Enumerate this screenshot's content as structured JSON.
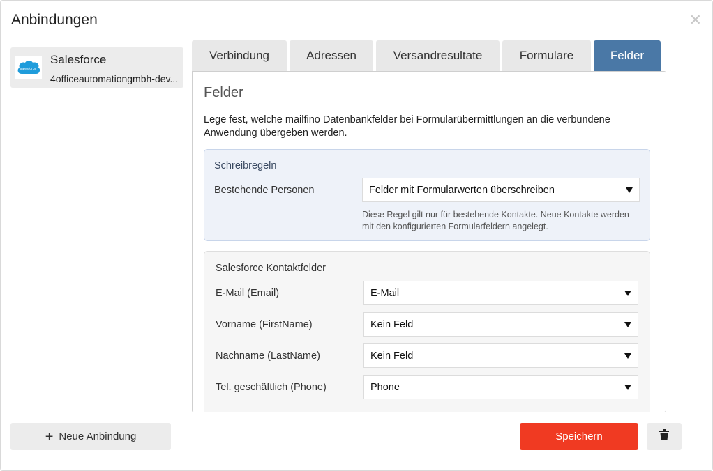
{
  "dialog": {
    "title": "Anbindungen",
    "close_glyph": "✕"
  },
  "connections": [
    {
      "name": "Salesforce",
      "account": "4officeautomationgmbh-dev...",
      "logo_text": "salesforce",
      "logo_color": "#1f9cdb"
    }
  ],
  "tabs": [
    {
      "label": "Verbindung"
    },
    {
      "label": "Adressen"
    },
    {
      "label": "Versandresultate"
    },
    {
      "label": "Formulare"
    },
    {
      "label": "Felder",
      "active": true
    }
  ],
  "panel": {
    "title": "Felder",
    "description": "Lege fest, welche mailfino Datenbankfelder bei Formularübermittlungen an die verbundene Anwendung übergeben werden.",
    "write_rules": {
      "title": "Schreibregeln",
      "label": "Bestehende Personen",
      "value": "Felder mit Formularwerten überschreiben",
      "hint": "Diese Regel gilt nur für bestehende Kontakte. Neue Kontakte werden mit den konfigurierten Formularfeldern angelegt."
    },
    "contact_fields": {
      "title": "Salesforce Kontaktfelder",
      "rows": [
        {
          "label": "E-Mail (Email)",
          "value": "E-Mail"
        },
        {
          "label": "Vorname (FirstName)",
          "value": "Kein Feld"
        },
        {
          "label": "Nachname (LastName)",
          "value": "Kein Feld"
        },
        {
          "label": "Tel. geschäftlich (Phone)",
          "value": "Phone"
        }
      ]
    }
  },
  "footer": {
    "new_label": "Neue Anbindung",
    "save_label": "Speichern"
  },
  "colors": {
    "accent": "#4a78a6",
    "save": "#f03a22"
  }
}
